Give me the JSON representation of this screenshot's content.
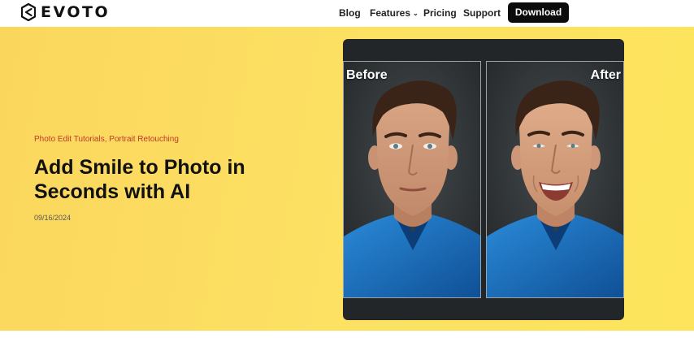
{
  "header": {
    "logo_text": "EVOTO",
    "nav": {
      "blog": "Blog",
      "features": "Features",
      "pricing": "Pricing",
      "support": "Support"
    },
    "download_label": "Download"
  },
  "hero": {
    "categories": [
      "Photo Edit Tutorials",
      "Portrait Retouching"
    ],
    "category_separator": ",",
    "title": "Add Smile to Photo in Seconds with AI",
    "date": "09/16/2024",
    "background_color": "#fcdc5e"
  },
  "comparison": {
    "before_label": "Before",
    "after_label": "After"
  },
  "colors": {
    "accent_red": "#c0392b",
    "button_black": "#0b0b0b",
    "shirt_blue": "#1f74c8"
  },
  "icons": {
    "logo": "evoto-hexagon-logo-icon",
    "features_chevron": "chevron-down-icon"
  }
}
